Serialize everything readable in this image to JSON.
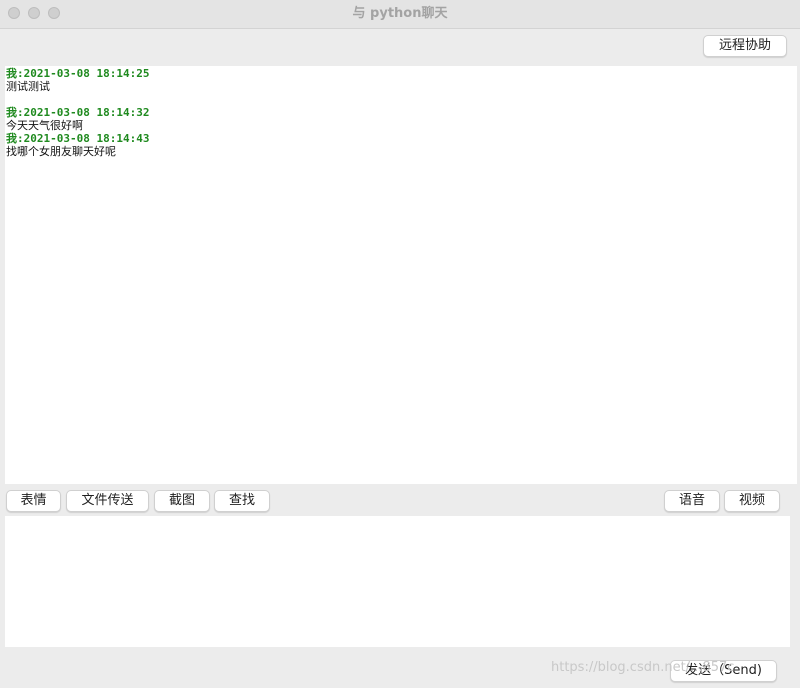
{
  "window": {
    "title": "与 python聊天"
  },
  "toolbar_top": {
    "remote_assist_label": "远程协助"
  },
  "chat": {
    "messages": [
      {
        "header": "我:2021-03-08 18:14:25",
        "body": "测试测试"
      },
      {
        "header": "我:2021-03-08 18:14:32",
        "body": "今天天气很好啊"
      },
      {
        "header": "我:2021-03-08 18:14:43",
        "body": "找哪个女朋友聊天好呢"
      }
    ]
  },
  "toolbar_bottom": {
    "emoji_label": "表情",
    "file_transfer_label": "文件传送",
    "screenshot_label": "截图",
    "search_label": "查找",
    "voice_label": "语音",
    "video_label": "视频"
  },
  "input": {
    "value": ""
  },
  "footer": {
    "send_label": "发送（Send)",
    "watermark": "https://blog.csdn.net/...857c"
  },
  "colors": {
    "message_header": "#1f8a1f",
    "message_body": "#111111",
    "window_bg": "#ececec",
    "title_text": "#a3a3a3"
  }
}
